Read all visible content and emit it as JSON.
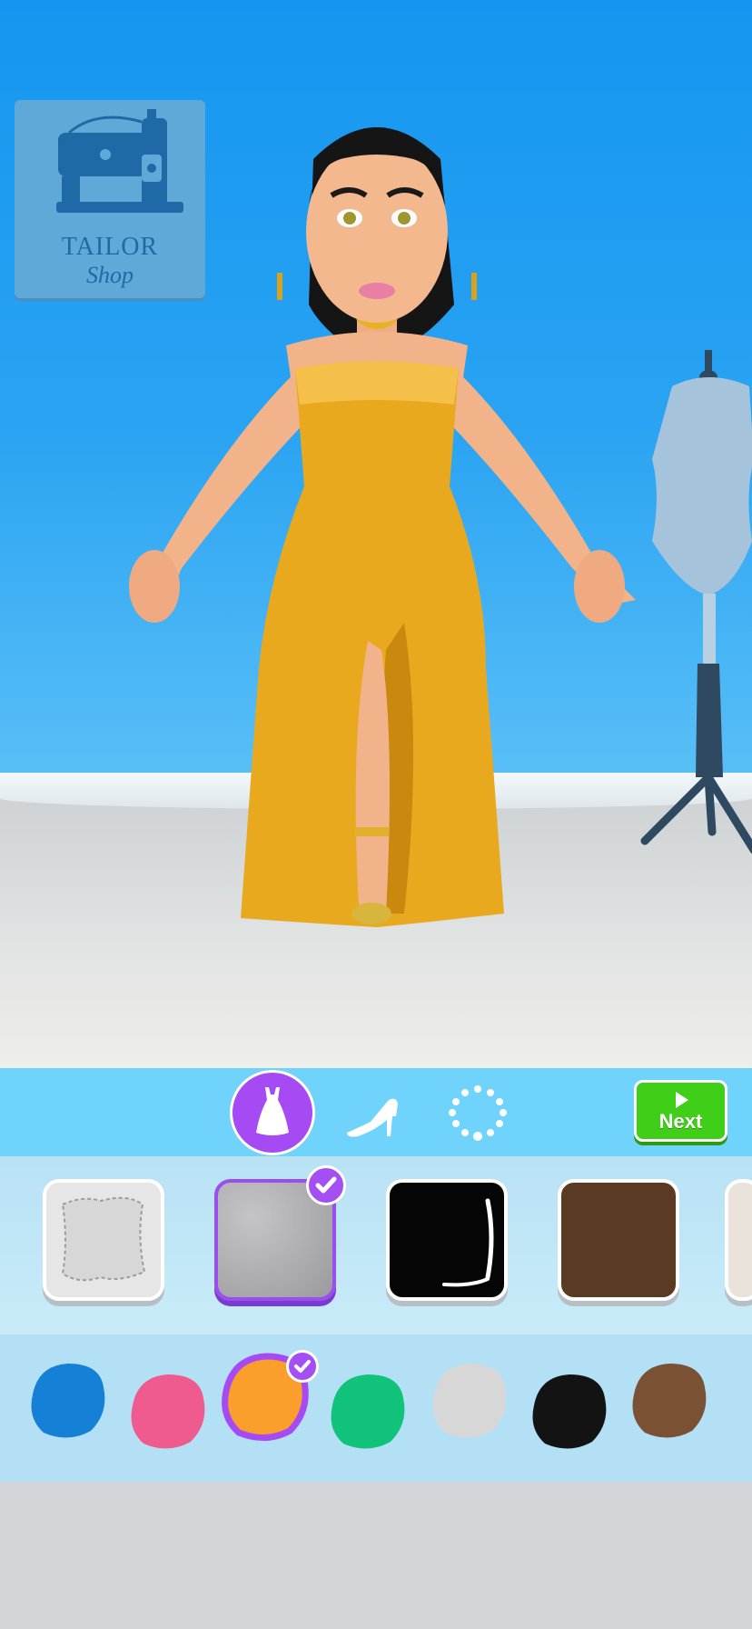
{
  "logo": {
    "line1": "TAILOR",
    "line2": "Shop"
  },
  "toolbar": {
    "tabs": [
      {
        "name": "dress",
        "icon": "dress-icon",
        "selected": true
      },
      {
        "name": "shoes",
        "icon": "high-heel-icon",
        "selected": false
      },
      {
        "name": "jewelry",
        "icon": "necklace-icon",
        "selected": false
      }
    ],
    "next_label": "Next"
  },
  "fabrics": [
    {
      "name": "white-quilt",
      "color": "#e6e6e6",
      "selected": false
    },
    {
      "name": "silver-glitter",
      "color": "#a9a9ab",
      "selected": true
    },
    {
      "name": "black-latex",
      "color": "#050505",
      "selected": false
    },
    {
      "name": "brown-leather",
      "color": "#5a3a22",
      "selected": false
    },
    {
      "name": "white-lace",
      "color": "#e9e3dc",
      "selected": false
    }
  ],
  "colors": [
    {
      "hex": "#1480d6",
      "selected": false
    },
    {
      "hex": "#ef5b8e",
      "selected": false
    },
    {
      "hex": "#fa9e2c",
      "selected": true
    },
    {
      "hex": "#10c27a",
      "selected": false
    },
    {
      "hex": "#d7d7d7",
      "selected": false
    },
    {
      "hex": "#131313",
      "selected": false
    },
    {
      "hex": "#7a5233",
      "selected": false
    }
  ],
  "accent_color": "#a64bf4",
  "next_color": "#3fcf18"
}
